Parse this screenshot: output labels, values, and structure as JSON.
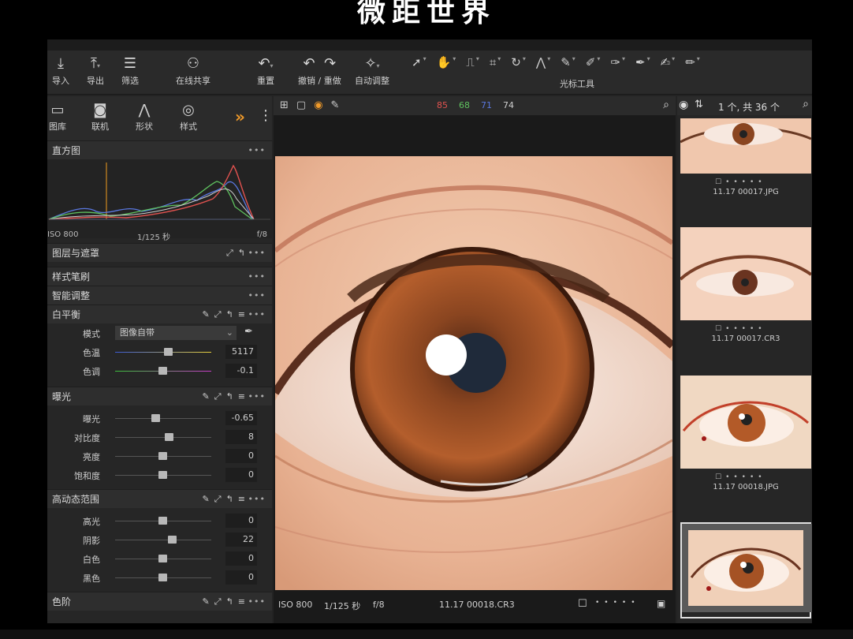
{
  "video_caption": "微距世界",
  "toolbar": {
    "buttons": [
      {
        "label": "导入",
        "icon": "import-icon"
      },
      {
        "label": "导出",
        "icon": "export-icon"
      },
      {
        "label": "筛选",
        "icon": "filter-icon"
      },
      {
        "label": "在线共享",
        "icon": "share-icon"
      },
      {
        "label": "重置",
        "icon": "reset-icon"
      },
      {
        "label": "撤销 / 重做",
        "icon": "undo-redo-icon"
      },
      {
        "label": "自动调整",
        "icon": "auto-adjust-icon"
      }
    ],
    "cursor_tools_label": "光标工具"
  },
  "tool_tabs": [
    {
      "label": "图库",
      "icon": "library-icon"
    },
    {
      "label": "联机",
      "icon": "tether-icon"
    },
    {
      "label": "形状",
      "icon": "shape-icon"
    },
    {
      "label": "样式",
      "icon": "style-icon"
    }
  ],
  "histogram": {
    "title": "直方图",
    "iso": "ISO 800",
    "shutter": "1/125 秒",
    "aperture": "f/8"
  },
  "sections": {
    "layers": "图层与遮罩",
    "style_brush": "样式笔刷",
    "smart_adjust": "智能调整",
    "white_balance": "白平衡",
    "exposure": "曝光",
    "hdr": "高动态范围",
    "levels": "色阶"
  },
  "white_balance": {
    "mode_label": "模式",
    "mode_value": "图像自带",
    "sliders": [
      {
        "label": "色温",
        "value": "5117",
        "position": 0.55
      },
      {
        "label": "色调",
        "value": "-0.1",
        "position": 0.49
      }
    ]
  },
  "exposure": {
    "sliders": [
      {
        "label": "曝光",
        "value": "-0.65",
        "position": 0.42
      },
      {
        "label": "对比度",
        "value": "8",
        "position": 0.56
      },
      {
        "label": "亮度",
        "value": "0",
        "position": 0.49
      },
      {
        "label": "饱和度",
        "value": "0",
        "position": 0.49
      }
    ]
  },
  "hdr": {
    "sliders": [
      {
        "label": "高光",
        "value": "0",
        "position": 0.49
      },
      {
        "label": "阴影",
        "value": "22",
        "position": 0.59
      },
      {
        "label": "白色",
        "value": "0",
        "position": 0.49
      },
      {
        "label": "黑色",
        "value": "0",
        "position": 0.49
      }
    ]
  },
  "viewer": {
    "r": "85",
    "g": "68",
    "b": "71",
    "l": "74",
    "status_iso": "ISO 800",
    "status_shutter": "1/125 秒",
    "status_aperture": "f/8",
    "status_file": "11.17 00018.CR3"
  },
  "browser": {
    "count": "1 个, 共 36 个",
    "thumbs": [
      {
        "name": "11.17 00017.JPG"
      },
      {
        "name": "11.17 00017.CR3"
      },
      {
        "name": "11.17 00018.JPG"
      },
      {
        "name": ""
      }
    ]
  },
  "colors": {
    "accent": "#f09a2a",
    "r_readout": "#e0524f",
    "g_readout": "#5fc25f",
    "b_readout": "#5a78e0"
  }
}
